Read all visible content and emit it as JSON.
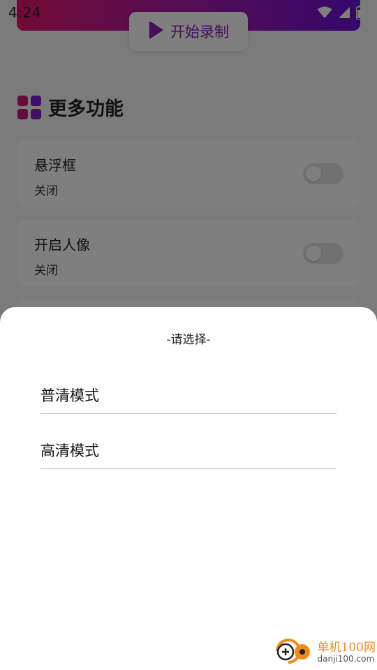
{
  "status_bar": {
    "time": "4:24"
  },
  "header": {
    "record_button_label": "开始录制",
    "gradient_colors": [
      "#e1156a",
      "#6a0fd6"
    ]
  },
  "section": {
    "title": "更多功能",
    "icon_colors": [
      "#d11574",
      "#7b19d8",
      "#c41681",
      "#8a1cc6"
    ]
  },
  "settings": {
    "items": [
      {
        "title": "悬浮框",
        "status": "关闭",
        "enabled": false
      },
      {
        "title": "开启人像",
        "status": "关闭",
        "enabled": false
      }
    ]
  },
  "dialog": {
    "title": "-请选择-",
    "options": [
      {
        "label": "普清模式"
      },
      {
        "label": "高清模式"
      }
    ]
  },
  "watermark": {
    "name": "单机100网",
    "url": "danji100.com"
  }
}
